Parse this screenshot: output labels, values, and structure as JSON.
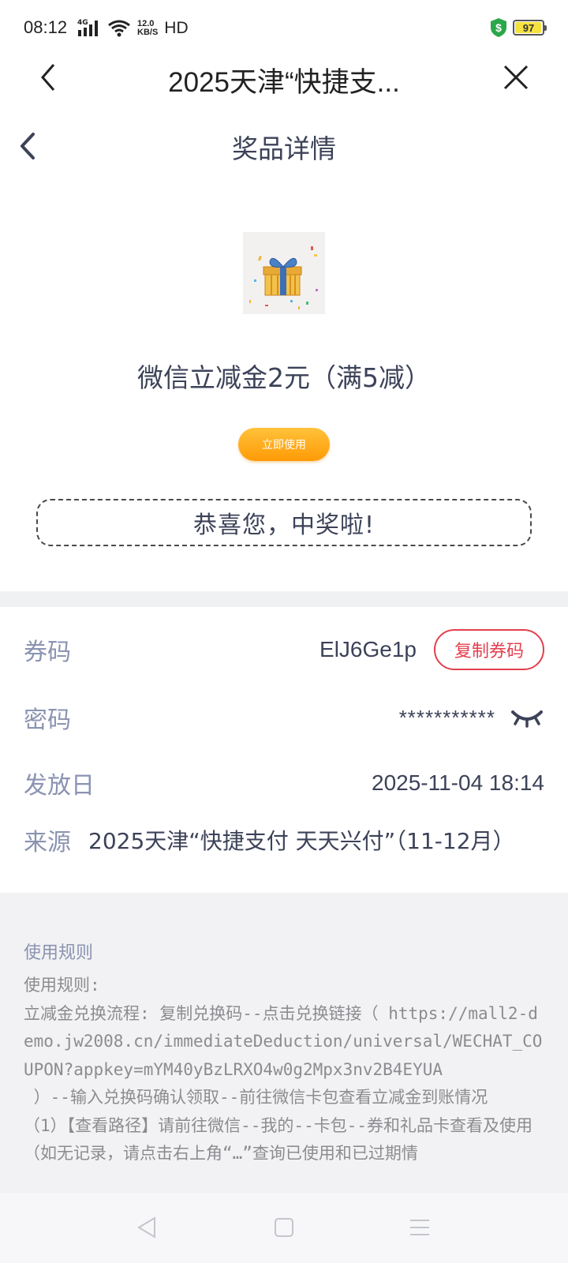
{
  "status_bar": {
    "time": "08:12",
    "network": "4G",
    "speed_value": "12.0",
    "speed_unit": "KB/S",
    "hd": "HD",
    "battery": "97",
    "battery_level": 0.97,
    "shield_color": "#2aa84a",
    "icons": [
      "signal-icon",
      "wifi-icon",
      "shield-dollar-icon",
      "battery-icon"
    ]
  },
  "titlebar": {
    "title": "2025天津“快捷支...",
    "back_icon": "chevron-left-icon",
    "close_icon": "close-icon"
  },
  "page": {
    "title": "奖品详情",
    "back_icon": "chevron-left-icon"
  },
  "prize": {
    "image_icon": "gift-box-icon",
    "name": "微信立减金2元（满5减）",
    "use_button": "立即使用",
    "congrats": "恭喜您，中奖啦!"
  },
  "details": {
    "code_label": "券码",
    "code_value": "ElJ6Ge1p",
    "copy_button": "复制券码",
    "password_label": "密码",
    "password_value": "***********",
    "password_icon": "eye-closed-icon",
    "date_label": "发放日",
    "date_value": "2025-11-04 18:14",
    "source_label": "来源",
    "source_value": "2025天津“快捷支付 天天兴付”（11-12月）"
  },
  "rules": {
    "title": "使用规则",
    "body": "使用规则:\n立减金兑换流程: 复制兑换码--点击兑换链接（ https://mall2-demo.jw2008.cn/immediateDeduction/universal/WECHAT_COUPON?appkey=mYM40yBzLRXO4w0g2Mpx3nv2B4EYUA\n ）--输入兑换码确认领取--前往微信卡包查看立减金到账情况\n（1）【查看路径】请前往微信--我的--卡包--券和礼品卡查看及使用（如无记录，请点击右上角“…”查询已使用和已过期情"
  },
  "navbar": {
    "back": "nav-back-icon",
    "home": "nav-home-icon",
    "menu": "nav-menu-icon"
  },
  "colors": {
    "text_primary": "#3c4258",
    "label": "#8a93b1",
    "accent_red": "#e3404e",
    "button_orange": "#ff9a06"
  }
}
